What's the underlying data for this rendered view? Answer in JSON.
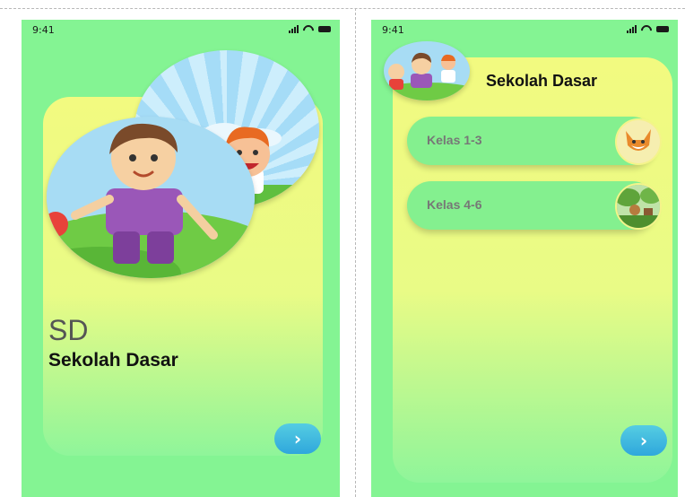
{
  "status_bar": {
    "time": "9:41"
  },
  "screen1": {
    "abbreviation": "SD",
    "title": "Sekolah Dasar",
    "next_label": "›"
  },
  "screen2": {
    "title": "Sekolah Dasar",
    "classes": [
      {
        "label": "Kelas 1-3"
      },
      {
        "label": "Kelas 4-6"
      }
    ],
    "next_label": "›"
  }
}
